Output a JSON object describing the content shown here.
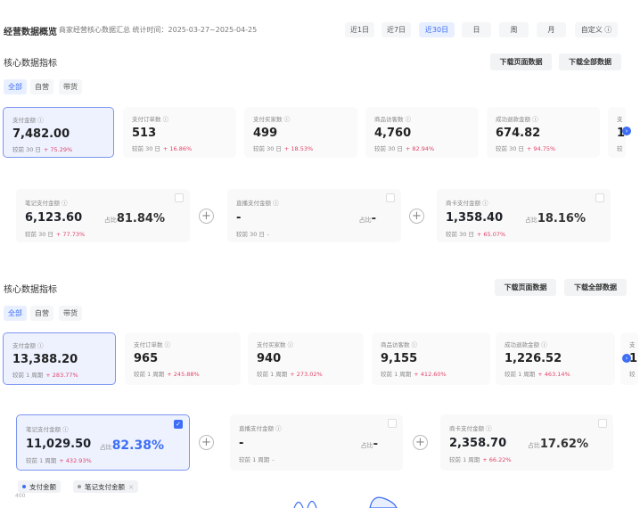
{
  "header": {
    "title": "经营数据概览",
    "subtitle": "商家经营核心数据汇总  统计时间：2025-03-27~2025-04-25",
    "ranges": [
      "近1日",
      "近7日",
      "近30日",
      "日",
      "周",
      "月",
      "自定义 ⓘ"
    ],
    "active_range": "近30日"
  },
  "sections": [
    {
      "title": "核心数据指标",
      "download_page": "下载页面数据",
      "download_all": "下载全部数据",
      "tabs": [
        "全部",
        "自营",
        "带货"
      ],
      "cards": [
        {
          "label": "支付金额 ⓘ",
          "value": "7,482.00",
          "compare": "较前 30 日",
          "pct": "+ 75.29%"
        },
        {
          "label": "支付订单数 ⓘ",
          "value": "513",
          "compare": "较前 30 日",
          "pct": "+ 16.86%"
        },
        {
          "label": "支付买家数 ⓘ",
          "value": "499",
          "compare": "较前 30 日",
          "pct": "+ 18.53%"
        },
        {
          "label": "商品访客数 ⓘ",
          "value": "4,760",
          "compare": "较前 30 日",
          "pct": "+ 82.94%"
        },
        {
          "label": "成功退款金额 ⓘ",
          "value": "674.82",
          "compare": "较前 30 日",
          "pct": "+ 94.75%"
        },
        {
          "label": "支",
          "value": "1",
          "compare": "较",
          "pct": ""
        }
      ],
      "subcards": [
        {
          "label": "笔记支付金额 ⓘ",
          "value": "6,123.60",
          "ratio_label": "占比",
          "ratio": "81.84%",
          "compare": "较前 30 日",
          "pct": "+ 77.73%",
          "checked": false
        },
        {
          "label": "直播支付金额 ⓘ",
          "value": "-",
          "ratio_label": "占比",
          "ratio": "-",
          "compare": "较前 30 日",
          "pct": "-",
          "checked": false
        },
        {
          "label": "商卡支付金额 ⓘ",
          "value": "1,358.40",
          "ratio_label": "占比",
          "ratio": "18.16%",
          "compare": "较前 30 日",
          "pct": "+ 65.07%",
          "checked": false
        }
      ]
    },
    {
      "title": "核心数据指标",
      "download_page": "下载页面数据",
      "download_all": "下载全部数据",
      "tabs": [
        "全部",
        "自营",
        "带货"
      ],
      "cards": [
        {
          "label": "支付金额 ⓘ",
          "value": "13,388.20",
          "compare": "较前 1 周期",
          "pct": "+ 283.77%"
        },
        {
          "label": "支付订单数 ⓘ",
          "value": "965",
          "compare": "较前 1 周期",
          "pct": "+ 245.88%"
        },
        {
          "label": "支付买家数 ⓘ",
          "value": "940",
          "compare": "较前 1 周期",
          "pct": "+ 273.02%"
        },
        {
          "label": "商品访客数 ⓘ",
          "value": "9,155",
          "compare": "较前 1 周期",
          "pct": "+ 412.60%"
        },
        {
          "label": "成功退款金额 ⓘ",
          "value": "1,226.52",
          "compare": "较前 1 周期",
          "pct": "+ 463.14%"
        },
        {
          "label": "支",
          "value": "1",
          "compare": "较",
          "pct": ""
        }
      ],
      "subcards": [
        {
          "label": "笔记支付金额 ⓘ",
          "value": "11,029.50",
          "ratio_label": "占比",
          "ratio": "82.38%",
          "compare": "较前 1 周期",
          "pct": "+ 432.93%",
          "checked": true
        },
        {
          "label": "直播支付金额 ⓘ",
          "value": "-",
          "ratio_label": "占比",
          "ratio": "-",
          "compare": "较前 1 周期",
          "pct": "-",
          "checked": false
        },
        {
          "label": "商卡支付金额 ⓘ",
          "value": "2,358.70",
          "ratio_label": "占比",
          "ratio": "17.62%",
          "compare": "较前 1 周期",
          "pct": "+ 66.22%",
          "checked": false
        }
      ]
    }
  ],
  "legend": [
    {
      "label": "支付金额",
      "color": "#3d6ef5"
    },
    {
      "label": "笔记支付金额",
      "color": "#999999",
      "close": "×"
    }
  ],
  "chart_axis_top": "400",
  "colors": {
    "accent": "#3d6ef5",
    "positive": "#e0456b"
  }
}
